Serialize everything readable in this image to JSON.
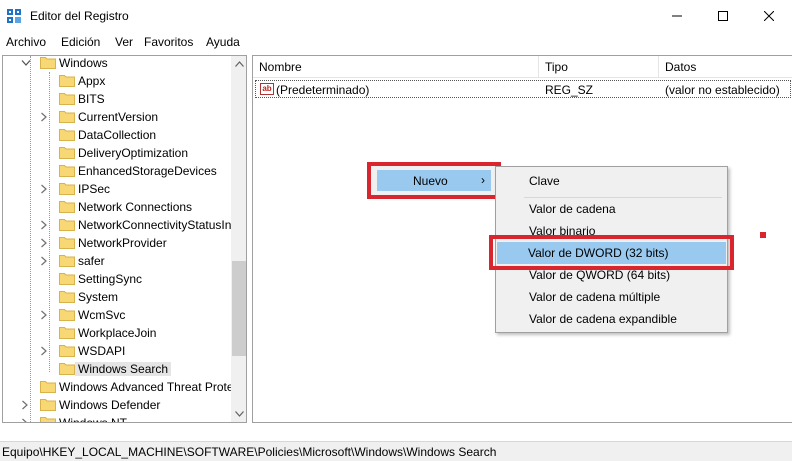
{
  "window": {
    "title": "Editor del Registro",
    "minimize": "–",
    "maximize": "☐",
    "close": "✕"
  },
  "menu": [
    "Archivo",
    "Edición",
    "Ver",
    "Favoritos",
    "Ayuda"
  ],
  "tree": {
    "parent": "Windows",
    "children": [
      {
        "label": "Appx",
        "expandable": false
      },
      {
        "label": "BITS",
        "expandable": false
      },
      {
        "label": "CurrentVersion",
        "expandable": true
      },
      {
        "label": "DataCollection",
        "expandable": false
      },
      {
        "label": "DeliveryOptimization",
        "expandable": false
      },
      {
        "label": "EnhancedStorageDevices",
        "expandable": false
      },
      {
        "label": "IPSec",
        "expandable": true
      },
      {
        "label": "Network Connections",
        "expandable": false
      },
      {
        "label": "NetworkConnectivityStatusIn",
        "expandable": true
      },
      {
        "label": "NetworkProvider",
        "expandable": true
      },
      {
        "label": "safer",
        "expandable": true
      },
      {
        "label": "SettingSync",
        "expandable": false
      },
      {
        "label": "System",
        "expandable": false
      },
      {
        "label": "WcmSvc",
        "expandable": true
      },
      {
        "label": "WorkplaceJoin",
        "expandable": false
      },
      {
        "label": "WSDAPI",
        "expandable": true
      },
      {
        "label": "Windows Search",
        "expandable": false,
        "selected": true
      }
    ],
    "siblings": [
      {
        "label": "Windows Advanced Threat Prote",
        "expandable": false
      },
      {
        "label": "Windows Defender",
        "expandable": true
      },
      {
        "label": "Windows NT",
        "expandable": true
      }
    ]
  },
  "list": {
    "columns": [
      "Nombre",
      "Tipo",
      "Datos"
    ],
    "rows": [
      {
        "name": "(Predeterminado)",
        "type": "REG_SZ",
        "data": "(valor no establecido)",
        "icon": "ab-string-icon"
      }
    ]
  },
  "context_menu": {
    "item": "Nuevo",
    "arrow": "›",
    "submenu": [
      "Clave",
      "Valor de cadena",
      "Valor binario",
      "Valor de DWORD (32 bits)",
      "Valor de QWORD (64 bits)",
      "Valor de cadena múltiple",
      "Valor de cadena expandible"
    ]
  },
  "status": "Equipo\\HKEY_LOCAL_MACHINE\\SOFTWARE\\Policies\\Microsoft\\Windows\\Windows Search",
  "colors": {
    "highlight": "#99c9ef",
    "annotation_red": "#d9252e",
    "folder": "#f8d775"
  }
}
